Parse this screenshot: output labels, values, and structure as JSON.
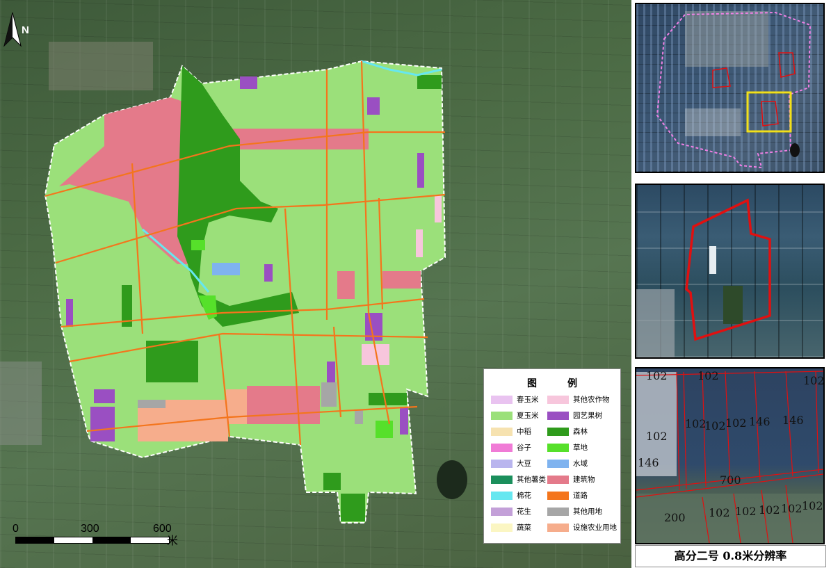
{
  "north": "N",
  "scale": {
    "labels": [
      "0",
      "300",
      "600"
    ],
    "unit": "米"
  },
  "legend": {
    "title_a": "图",
    "title_b": "例",
    "items": [
      {
        "label": "春玉米",
        "color": "#e9c3f0"
      },
      {
        "label": "其他农作物",
        "color": "#f7c6dc"
      },
      {
        "label": "夏玉米",
        "color": "#9be07a"
      },
      {
        "label": "园艺果树",
        "color": "#9a4fc2"
      },
      {
        "label": "中稻",
        "color": "#f6e2b0"
      },
      {
        "label": "森林",
        "color": "#2f9b1c"
      },
      {
        "label": "谷子",
        "color": "#f07bd6"
      },
      {
        "label": "草地",
        "color": "#56e02a"
      },
      {
        "label": "大豆",
        "color": "#b9b5ee"
      },
      {
        "label": "水域",
        "color": "#7fb3ef"
      },
      {
        "label": "其他薯类",
        "color": "#1b8f5c"
      },
      {
        "label": "建筑物",
        "color": "#e47a8a"
      },
      {
        "label": "棉花",
        "color": "#66e7f0"
      },
      {
        "label": "道路",
        "color": "#f4751c"
      },
      {
        "label": "花生",
        "color": "#c3a0d8"
      },
      {
        "label": "其他用地",
        "color": "#a6a6a6"
      },
      {
        "label": "蔬菜",
        "color": "#fbf6c3"
      },
      {
        "label": "设施农业用地",
        "color": "#f6ad8c"
      }
    ]
  },
  "codes": [
    "102",
    "102",
    "102",
    "102",
    "102",
    "102",
    "146",
    "146",
    "102",
    "146",
    "700",
    "200",
    "102",
    "102",
    "102",
    "102",
    "102"
  ],
  "caption": "高分二号 0.8米分辨率"
}
